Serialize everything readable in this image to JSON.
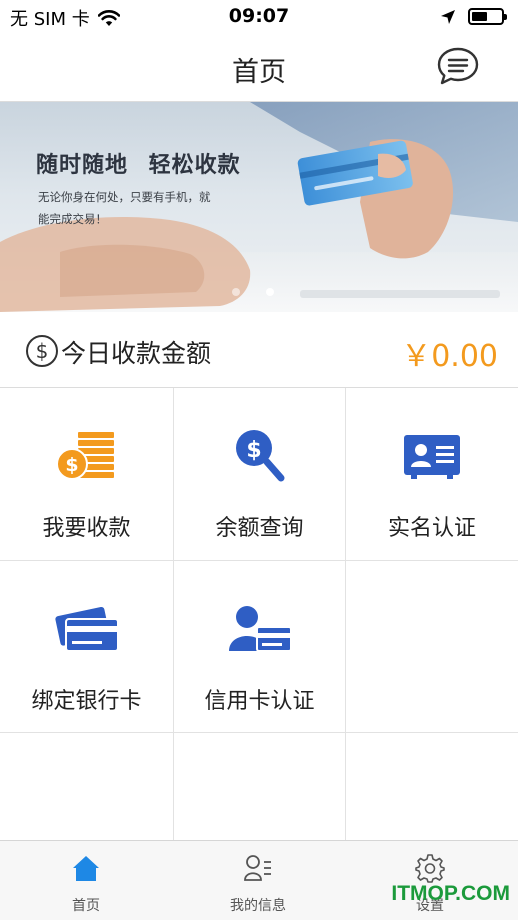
{
  "status_bar": {
    "carrier": "无 SIM 卡",
    "time": "09:07",
    "battery_level": 0.55
  },
  "nav": {
    "title": "首页",
    "message_icon": "chat-bubble-icon"
  },
  "banner": {
    "headline": "随时随地 轻松收款",
    "subtitle": "无论你身在何处，只要有手机，就能完成交易！",
    "active_slide": 2,
    "slide_count": 2
  },
  "amount": {
    "label": "今日收款金额",
    "value": "￥0.00",
    "icon": "dollar-circle-icon"
  },
  "menu": [
    {
      "label": "我要收款",
      "icon": "coins-icon"
    },
    {
      "label": "余额查询",
      "icon": "search-dollar-icon"
    },
    {
      "label": "实名认证",
      "icon": "id-card-icon"
    },
    {
      "label": "绑定银行卡",
      "icon": "bank-card-icon"
    },
    {
      "label": "信用卡认证",
      "icon": "user-card-icon"
    }
  ],
  "tabs": [
    {
      "label": "首页",
      "icon": "home-icon",
      "active": true
    },
    {
      "label": "我的信息",
      "icon": "user-list-icon",
      "active": false
    },
    {
      "label": "设置",
      "icon": "gear-icon",
      "active": false
    }
  ],
  "watermark": "ITMOP.COM",
  "colors": {
    "accent_blue": "#2f5ec4",
    "amount_orange": "#f39a1e",
    "tab_active_blue": "#1e88e5",
    "watermark_green": "#1b9a3b"
  }
}
